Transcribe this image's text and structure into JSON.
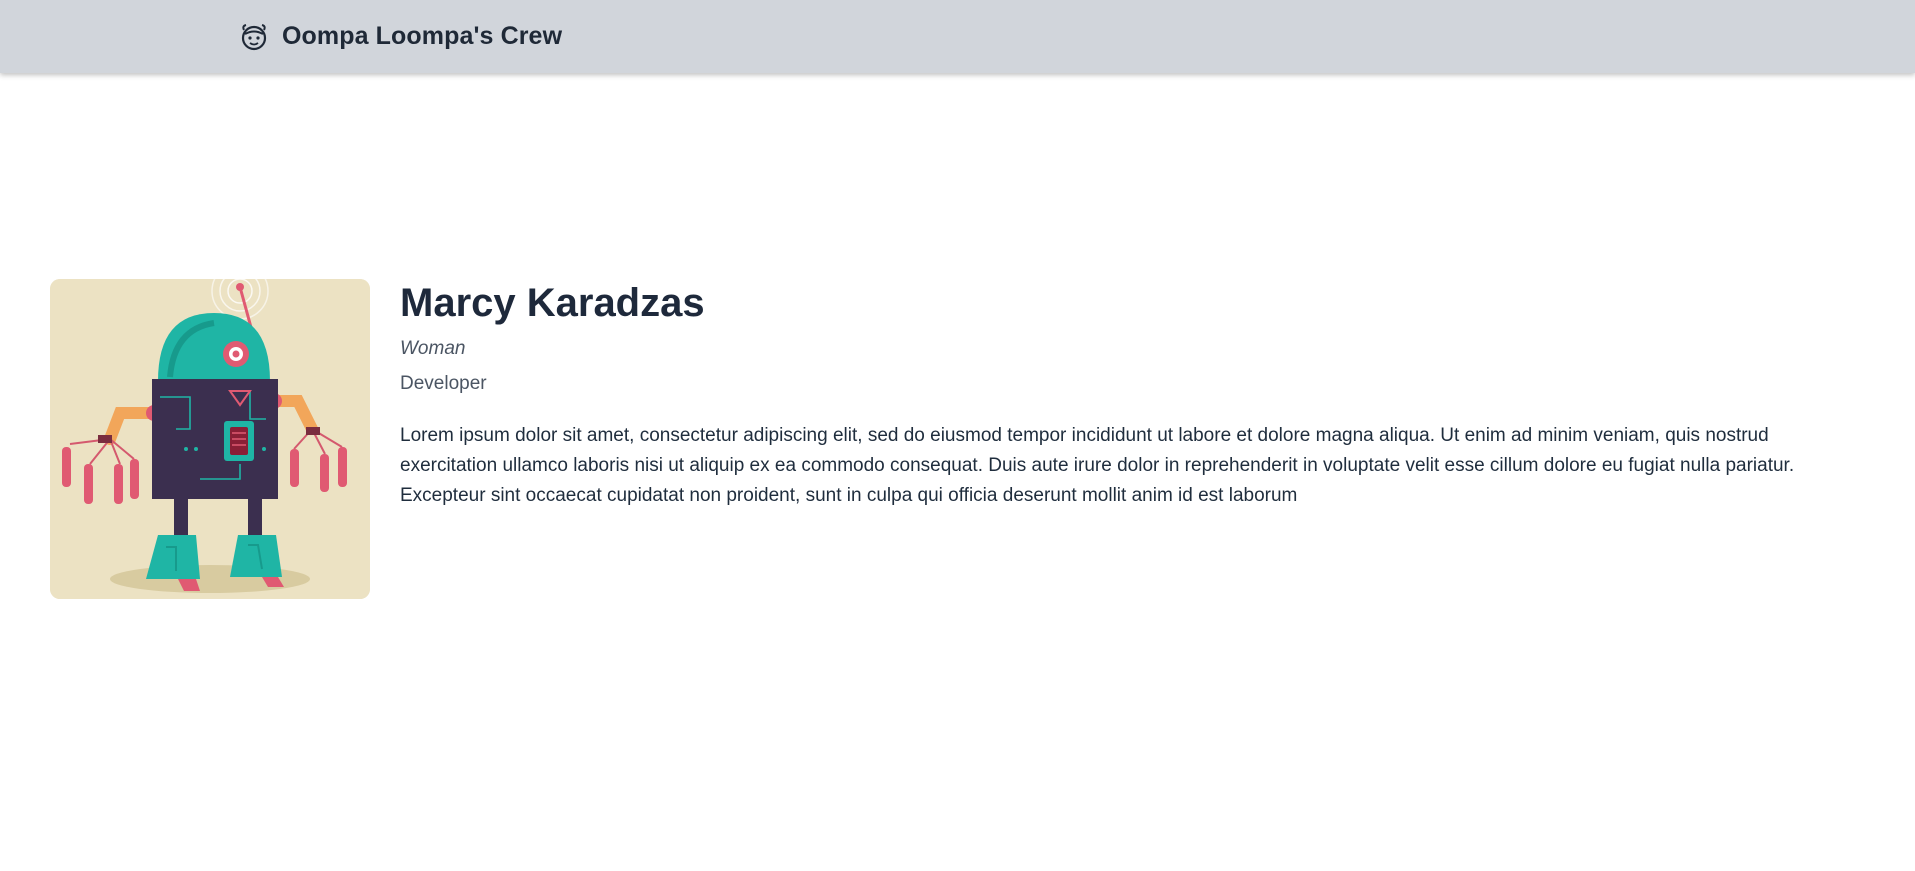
{
  "header": {
    "title": "Oompa Loompa's Crew",
    "logo_icon": "oompa-loompa-face-icon"
  },
  "profile": {
    "image_icon": "robot-illustration",
    "name": "Marcy Karadzas",
    "gender": "Woman",
    "profession": "Developer",
    "description": "Lorem ipsum dolor sit amet, consectetur adipiscing elit, sed do eiusmod tempor incididunt ut labore et dolore magna aliqua. Ut enim ad minim veniam, quis nostrud exercitation ullamco laboris nisi ut aliquip ex ea commodo consequat. Duis aute irure dolor in reprehenderit in voluptate velit esse cillum dolore eu fugiat nulla pariatur. Excepteur sint occaecat cupidatat non proident, sunt in culpa qui officia deserunt mollit anim id est laborum"
  },
  "colors": {
    "header_bg": "#d1d5db",
    "text_dark": "#1e293b",
    "text_muted": "#4b5563",
    "robot_teal": "#1fb5a5",
    "robot_body": "#3b2f4f",
    "robot_pink": "#e05a72",
    "robot_orange": "#f2a65a",
    "image_bg": "#ece2c3"
  }
}
